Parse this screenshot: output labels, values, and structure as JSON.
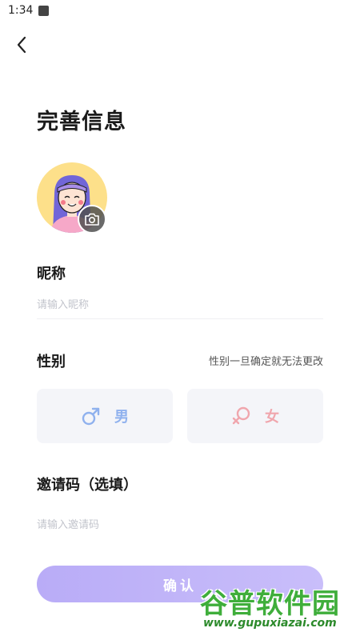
{
  "status_bar": {
    "time": "1:34"
  },
  "header": {
    "back_icon": "chevron-left-icon"
  },
  "page": {
    "title": "完善信息"
  },
  "avatar": {
    "camera_icon": "camera-icon",
    "bg_color": "#fde08a"
  },
  "nickname": {
    "label": "昵称",
    "placeholder": "请输入昵称",
    "value": ""
  },
  "gender": {
    "label": "性别",
    "note": "性别一旦确定就无法更改",
    "options": [
      {
        "label": "男",
        "icon": "male-symbol-icon",
        "color": "#8fb1ee"
      },
      {
        "label": "女",
        "icon": "female-symbol-icon",
        "color": "#f0a6ad"
      }
    ]
  },
  "invite": {
    "label": "邀请码（选填）",
    "placeholder": "请输入邀请码",
    "value": ""
  },
  "confirm": {
    "label": "确认",
    "color": "#b9acf7"
  },
  "watermark": {
    "title": "谷普软件园",
    "url": "www.gupuxiazai.com"
  }
}
